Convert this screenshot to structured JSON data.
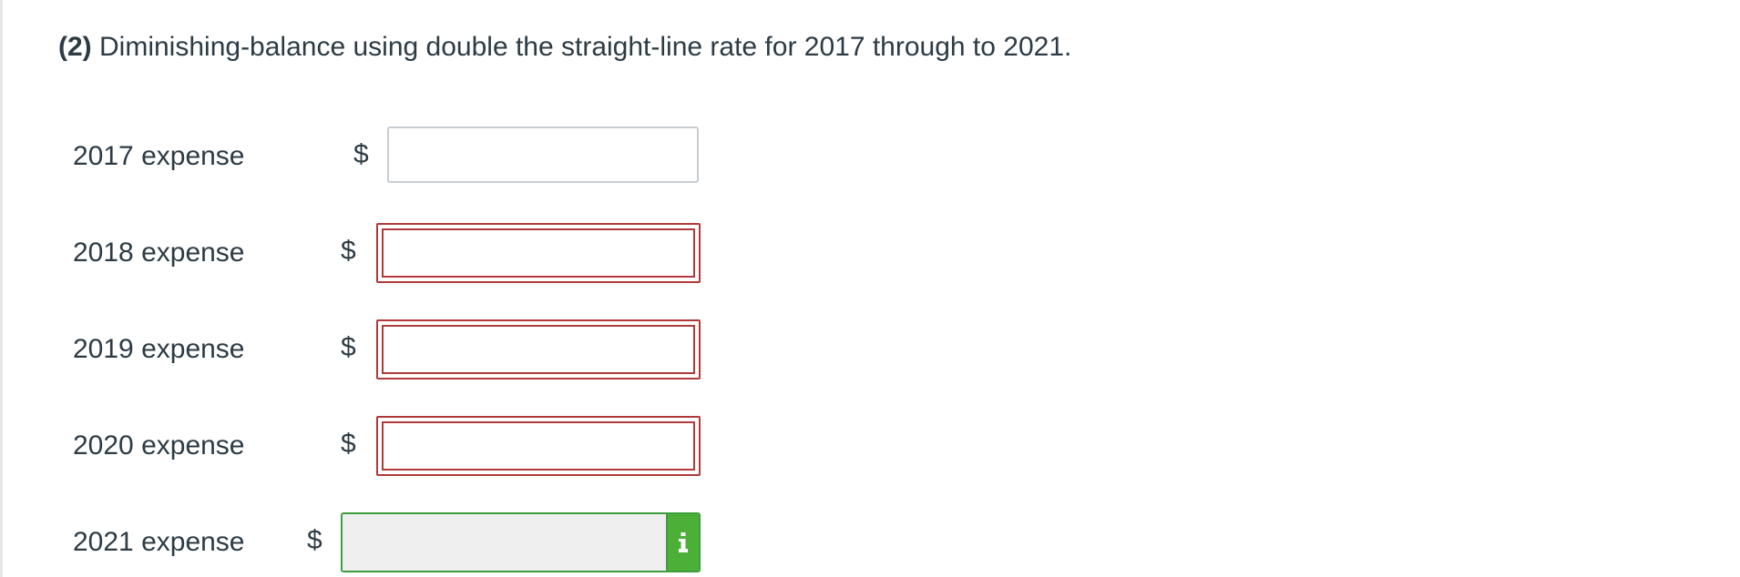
{
  "question": {
    "number": "(2)",
    "text": "Diminishing-balance using double the straight-line rate for 2017 through to 2021."
  },
  "currency_symbol": "$",
  "rows": [
    {
      "label": "2017 expense",
      "value": "",
      "state": "unanswered"
    },
    {
      "label": "2018 expense",
      "value": "",
      "state": "incorrect"
    },
    {
      "label": "2019 expense",
      "value": "",
      "state": "incorrect"
    },
    {
      "label": "2020 expense",
      "value": "",
      "state": "incorrect"
    },
    {
      "label": "2021 expense",
      "value": "",
      "state": "correct",
      "info_icon": "info-icon"
    }
  ],
  "colors": {
    "incorrect_border": "#b03a3a",
    "correct_border": "#3d9e3d",
    "info_button_bg": "#4caf38",
    "text": "#2d3b45"
  }
}
